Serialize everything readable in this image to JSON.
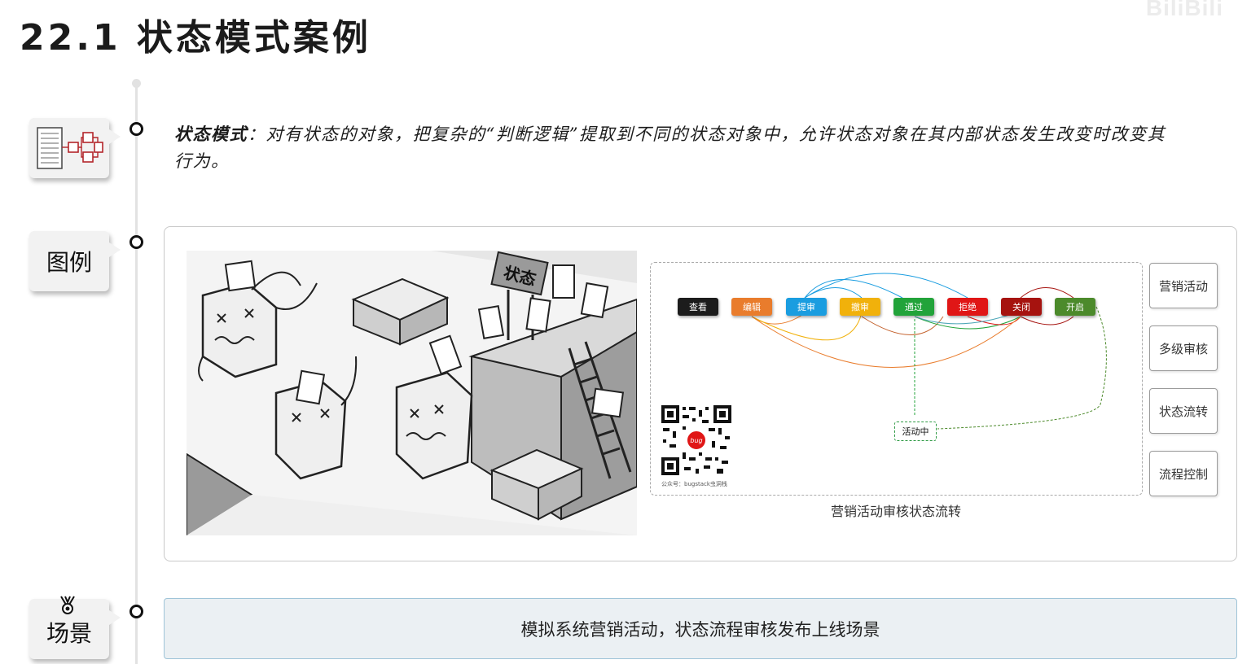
{
  "title": "22.1 状态模式案例",
  "watermark": "BiliBili",
  "description": {
    "term": "状态模式",
    "text": "：对有状态的对象，把复杂的“判断逻辑”提取到不同的状态对象中，允许状态对象在其内部状态发生改变时改变其行为。"
  },
  "sections": {
    "figure_label": "图例",
    "scene_label": "场景"
  },
  "comic": {
    "sign_text": "状态"
  },
  "flow": {
    "nodes": [
      {
        "label": "查看",
        "color": "#1c1c1c"
      },
      {
        "label": "编辑",
        "color": "#e97c2c"
      },
      {
        "label": "提审",
        "color": "#1a9de0"
      },
      {
        "label": "撤审",
        "color": "#f1b10b"
      },
      {
        "label": "通过",
        "color": "#22a33a"
      },
      {
        "label": "拒绝",
        "color": "#e01616"
      },
      {
        "label": "关闭",
        "color": "#a6130f"
      },
      {
        "label": "开启",
        "color": "#4c8a2b"
      }
    ],
    "active_node": "活动中",
    "qr_caption": "公众号：bugstack虫洞栈",
    "qr_logo": "bug",
    "caption": "营销活动审核状态流转"
  },
  "side_buttons": [
    "营销活动",
    "多级审核",
    "状态流转",
    "流程控制"
  ],
  "scene": "模拟系统营销活动，状态流程审核发布上线场景"
}
